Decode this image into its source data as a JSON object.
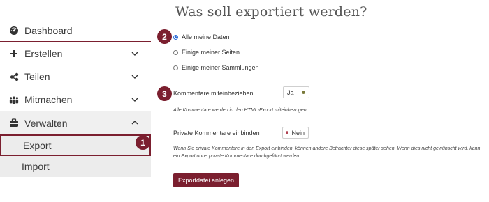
{
  "sidebar": {
    "items": [
      {
        "label": "Dashboard",
        "icon": "dashboard-icon"
      },
      {
        "label": "Erstellen",
        "icon": "plus-icon"
      },
      {
        "label": "Teilen",
        "icon": "share-icon"
      },
      {
        "label": "Mitmachen",
        "icon": "people-icon"
      },
      {
        "label": "Verwalten",
        "icon": "briefcase-icon"
      }
    ],
    "sub_items": [
      {
        "label": "Export"
      },
      {
        "label": "Import"
      }
    ]
  },
  "badges": {
    "b1": "1",
    "b2": "2",
    "b3": "3"
  },
  "main": {
    "title": "Was soll exportiert werden?",
    "options": [
      {
        "label": "Alle meine Daten",
        "checked": true
      },
      {
        "label": "Einige meiner Seiten",
        "checked": false
      },
      {
        "label": "Einige meiner Sammlungen",
        "checked": false
      }
    ],
    "comments": {
      "label": "Kommentare miteinbeziehen",
      "toggle_value": "Ja",
      "toggle_dot_color": "#7a7a3a",
      "hint": "Alle Kommentare werden in den HTML-Export miteinbezogen."
    },
    "private_comments": {
      "label": "Private Kommentare einbinden",
      "toggle_value": "Nein",
      "toggle_dot_color": "#b04050",
      "hint_line1": "Wenn Sie private Kommentare in den Export einbinden, können andere Betrachter diese später sehen. Wenn dies nicht gewünscht wird, kann",
      "hint_line2": "ein Export ohne private Kommentare durchgeführt werden."
    },
    "submit_label": "Exportdatei anlegen"
  },
  "colors": {
    "accent": "#7b1f2f",
    "radio_selected": "#2a6cd6"
  }
}
